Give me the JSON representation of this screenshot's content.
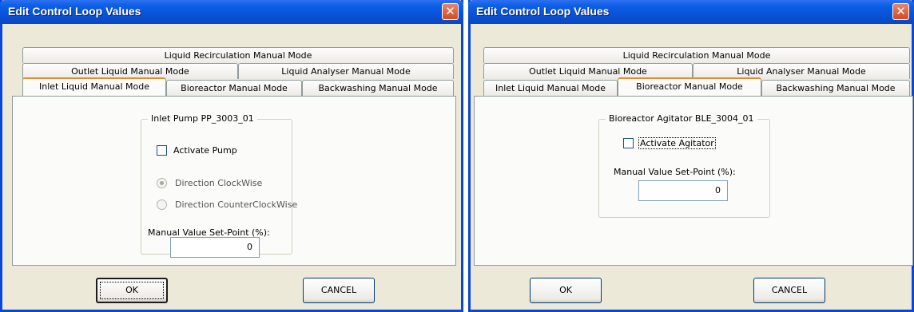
{
  "dialog1": {
    "title": "Edit Control Loop Values",
    "close_glyph": "✕",
    "tabs": {
      "recirculation": "Liquid Recirculation Manual Mode",
      "outlet": "Outlet Liquid Manual Mode",
      "analyser": "Liquid Analyser Manual Mode",
      "inlet": "Inlet Liquid Manual Mode",
      "bioreactor": "Bioreactor Manual Mode",
      "backwashing": "Backwashing Manual Mode"
    },
    "active_tab": "Inlet Liquid Manual Mode",
    "group_title": "Inlet Pump PP_3003_01",
    "activate_label": "Activate Pump",
    "activate_checked": false,
    "direction_cw_label": "Direction ClockWise",
    "direction_cw_selected": true,
    "direction_ccw_label": "Direction CounterClockWise",
    "direction_ccw_selected": false,
    "setpoint_label": "Manual Value Set-Point (%):",
    "setpoint_value": "0",
    "ok_label": "OK",
    "cancel_label": "CANCEL"
  },
  "dialog2": {
    "title": "Edit Control Loop Values",
    "close_glyph": "✕",
    "tabs": {
      "recirculation": "Liquid Recirculation Manual Mode",
      "outlet": "Outlet Liquid Manual Mode",
      "analyser": "Liquid Analyser Manual Mode",
      "inlet": "Inlet Liquid Manual Mode",
      "bioreactor": "Bioreactor Manual Mode",
      "backwashing": "Backwashing Manual Mode"
    },
    "active_tab": "Bioreactor Manual Mode",
    "group_title": "Bioreactor Agitator BLE_3004_01",
    "activate_label": "Activate Agitator",
    "activate_checked": false,
    "setpoint_label": "Manual Value Set-Point (%):",
    "setpoint_value": "0",
    "ok_label": "OK",
    "cancel_label": "CANCEL"
  }
}
